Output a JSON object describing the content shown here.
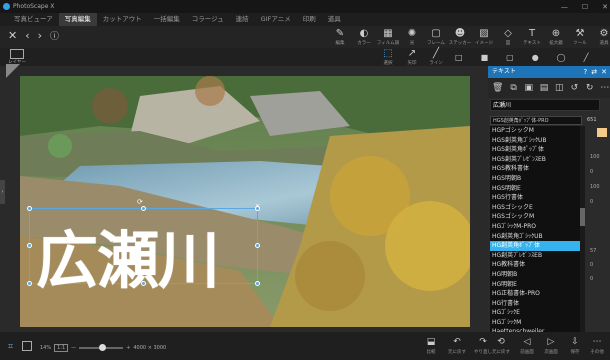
{
  "app": {
    "title": "PhotoScape X",
    "window_controls": [
      "—",
      "☐",
      "✕"
    ]
  },
  "menu": [
    {
      "label": "写真ビューア",
      "active": false
    },
    {
      "label": "写真編集",
      "active": true
    },
    {
      "label": "カットアウト",
      "active": false
    },
    {
      "label": "一括編集",
      "active": false
    },
    {
      "label": "コラージュ",
      "active": false
    },
    {
      "label": "連結",
      "active": false
    },
    {
      "label": "GIFアニメ",
      "active": false
    },
    {
      "label": "印刷",
      "active": false
    },
    {
      "label": "道具",
      "active": false
    }
  ],
  "top_tools": [
    {
      "label": "編集",
      "icon": "edit-icon"
    },
    {
      "label": "カラー",
      "icon": "color-icon"
    },
    {
      "label": "フィルム調",
      "icon": "film-icon"
    },
    {
      "label": "光",
      "icon": "light-icon"
    },
    {
      "label": "フレーム",
      "icon": "frame-icon"
    },
    {
      "label": "ステッカー",
      "icon": "sticker-icon"
    },
    {
      "label": "イメージ",
      "icon": "image-icon"
    },
    {
      "label": "図",
      "icon": "figure-icon"
    },
    {
      "label": "テキスト",
      "icon": "text-icon"
    },
    {
      "label": "拡大鏡",
      "icon": "magnifier-icon"
    },
    {
      "label": "ツール",
      "icon": "tool-icon"
    },
    {
      "label": "道具",
      "icon": "tools-icon"
    }
  ],
  "sub_tools": [
    {
      "label": "選択",
      "icon": "select-icon"
    },
    {
      "label": "矢印",
      "icon": "arrow-icon"
    },
    {
      "label": "ライン",
      "icon": "line-icon"
    }
  ],
  "layer_button": {
    "label": "レイヤー"
  },
  "canvas": {
    "overlay_text": "広瀬川",
    "photo_alt": "Photo: river with rocky bank, autumn trees and green hillside"
  },
  "text_panel": {
    "title": "テキスト",
    "text_value": "広瀬川",
    "selected_font": "HGS創英角ﾎﾟｯﾌﾟ体-PRO",
    "font_size": "651",
    "side_numbers": [
      "100",
      "0",
      "100",
      "0",
      "57",
      "0",
      "0"
    ],
    "fonts": [
      "HGPゴシックM",
      "HGS創英角ｺﾞｼｯｸUB",
      "HGS創英角ﾎﾟｯﾌﾟ体",
      "HGS創英ﾌﾟﾚｾﾞﾝｽEB",
      "HGS教科書体",
      "HGS明朝B",
      "HGS明朝E",
      "HGS行書体",
      "HGSゴシックE",
      "HGSゴシックM",
      "HGｺﾞｼｯｸM-PRO",
      "HG創英角ｺﾞｼｯｸUB",
      "HG創英角ﾎﾟｯﾌﾟ体",
      "HG創英ﾌﾟﾚｾﾞﾝｽEB",
      "HG教科書体",
      "HG明朝B",
      "HG明朝E",
      "HG正楷書体-PRO",
      "HG行書体",
      "HGｺﾞｼｯｸE",
      "HGｺﾞｼｯｸM",
      "Haettenschweiler"
    ],
    "selected_index": 12
  },
  "bottom": {
    "zoom_label": "14%",
    "image_size": "4000 × 3000",
    "buttons": [
      {
        "label": "比較",
        "icon": "compare-icon"
      },
      {
        "label": "元に戻す",
        "icon": "undo-icon"
      },
      {
        "label": "やり直し",
        "icon": "redo-icon"
      },
      {
        "label": "元に戻す",
        "icon": "revert-icon"
      },
      {
        "label": "前画面",
        "icon": "prev-icon"
      },
      {
        "label": "次画面",
        "icon": "next-icon"
      },
      {
        "label": "保存",
        "icon": "save-icon"
      },
      {
        "label": "その他",
        "icon": "more-icon"
      }
    ]
  }
}
